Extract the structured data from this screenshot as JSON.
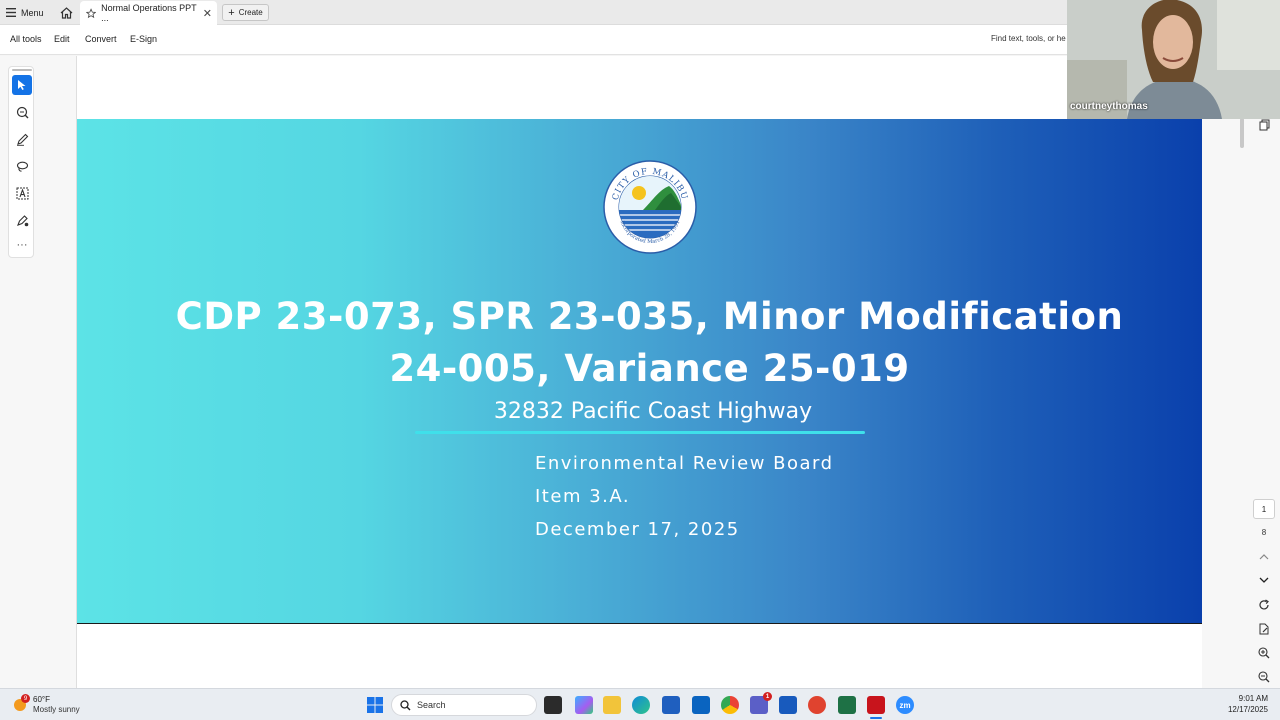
{
  "tabbar": {
    "menu_label": "Menu",
    "doc_tab_title": "Normal Operations PPT ...",
    "create_label": "Create"
  },
  "toolbar": {
    "items": [
      "All tools",
      "Edit",
      "Convert",
      "E-Sign"
    ],
    "find_placeholder": "Find text, tools, or he"
  },
  "left_rail": {
    "tools": [
      "select-cursor-icon",
      "comment-zoom-icon",
      "pen-icon",
      "lasso-icon",
      "text-select-icon",
      "stamp-icon",
      "more-icon"
    ]
  },
  "slide": {
    "seal_text_top": "CITY OF MALIBU",
    "seal_text_bottom": "Incorporated March 28, 1991",
    "title_line1": "CDP 23-073, SPR 23-035, Minor Modification",
    "title_line2": "24-005, Variance 25-019",
    "address": "32832 Pacific Coast Highway",
    "meta_line1": "Environmental Review Board",
    "meta_line2": "Item 3.A.",
    "meta_line3": "December 17, 2025",
    "colors": {
      "gradient_left": "#5ce3e6",
      "gradient_right": "#0a40ac",
      "underline": "#3fe0ea"
    }
  },
  "right_rail": {
    "current_page": "1",
    "total_pages": "8"
  },
  "webcam": {
    "participant_name": "courtneythomas"
  },
  "taskbar": {
    "weather_temp": "60°F",
    "weather_desc": "Mostly sunny",
    "weather_badge": "9",
    "search_label": "Search",
    "clock_time": "9:01 AM",
    "clock_date": "12/17/2025",
    "teams_badge": "1",
    "zoom_label": "zm"
  }
}
